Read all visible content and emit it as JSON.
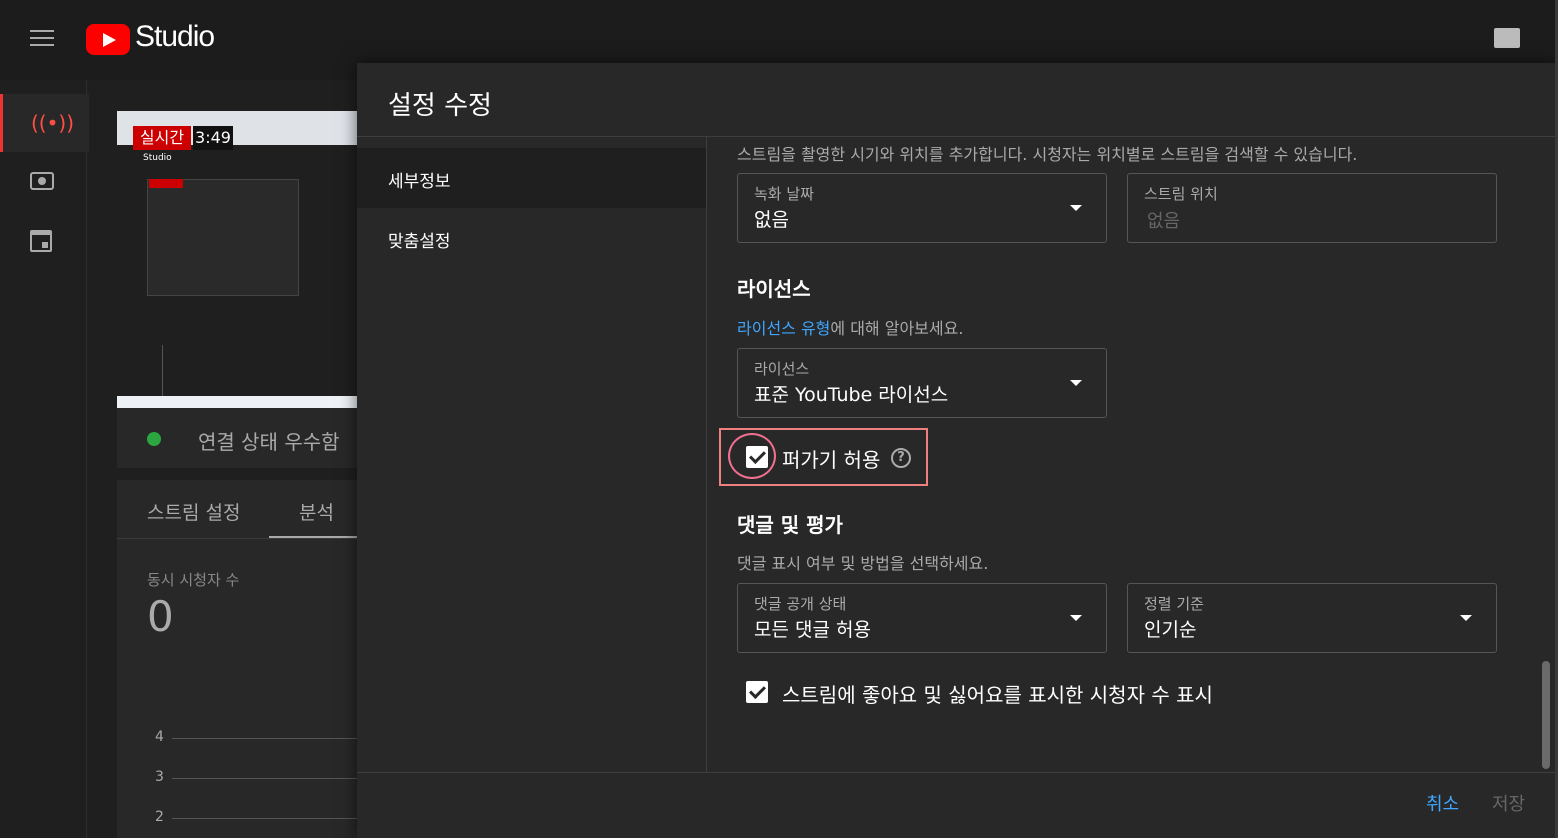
{
  "app": {
    "logo_text": "Studio",
    "colors": {
      "brand_red": "#ff0000",
      "link_blue": "#3ea6ff",
      "live_red": "#cc0000",
      "status_green": "#2ba640"
    }
  },
  "topbar": {
    "menu_icon": "hamburger-icon",
    "create_icon": "clapperboard-icon"
  },
  "leftnav": {
    "items": [
      {
        "icon": "live-broadcast-icon",
        "active": true
      },
      {
        "icon": "camera-icon",
        "active": false
      },
      {
        "icon": "calendar-icon",
        "active": false
      }
    ]
  },
  "preview": {
    "live_badge": "실시간",
    "elapsed": "3:49",
    "inner_logo": "Studio"
  },
  "connection": {
    "status_text": "연결 상태 우수함"
  },
  "analytics": {
    "tabs": [
      {
        "label": "스트림 설정"
      },
      {
        "label": "분석"
      }
    ],
    "viewers_label": "동시 시청자 수",
    "viewers_value": "0",
    "chart_ticks": [
      "4",
      "3",
      "2"
    ]
  },
  "dialog": {
    "title": "설정 수정",
    "side_tabs": [
      {
        "label": "세부정보"
      },
      {
        "label": "맞춤설정"
      }
    ],
    "location_help": "스트림을 촬영한 시기와 위치를 추가합니다. 시청자는 위치별로 스트림을 검색할 수 있습니다.",
    "recording_date": {
      "label": "녹화 날짜",
      "value": "없음"
    },
    "stream_location": {
      "label": "스트림 위치",
      "placeholder": "없음"
    },
    "license": {
      "heading": "라이선스",
      "help_link": "라이선스 유형",
      "help_suffix": "에 대해 알아보세요.",
      "field_label": "라이선스",
      "field_value": "표준 YouTube 라이선스"
    },
    "allow_embedding": {
      "label": "퍼가기 허용",
      "checked": true,
      "help_icon": "help-circle-icon"
    },
    "comments": {
      "heading": "댓글 및 평가",
      "help": "댓글 표시 여부 및 방법을 선택하세요.",
      "visibility": {
        "label": "댓글 공개 상태",
        "value": "모든 댓글 허용"
      },
      "sort": {
        "label": "정렬 기준",
        "value": "인기순"
      }
    },
    "show_likes": {
      "label": "스트림에 좋아요 및 싫어요를 표시한 시청자 수 표시",
      "checked": true
    },
    "buttons": {
      "cancel": "취소",
      "save": "저장"
    }
  }
}
